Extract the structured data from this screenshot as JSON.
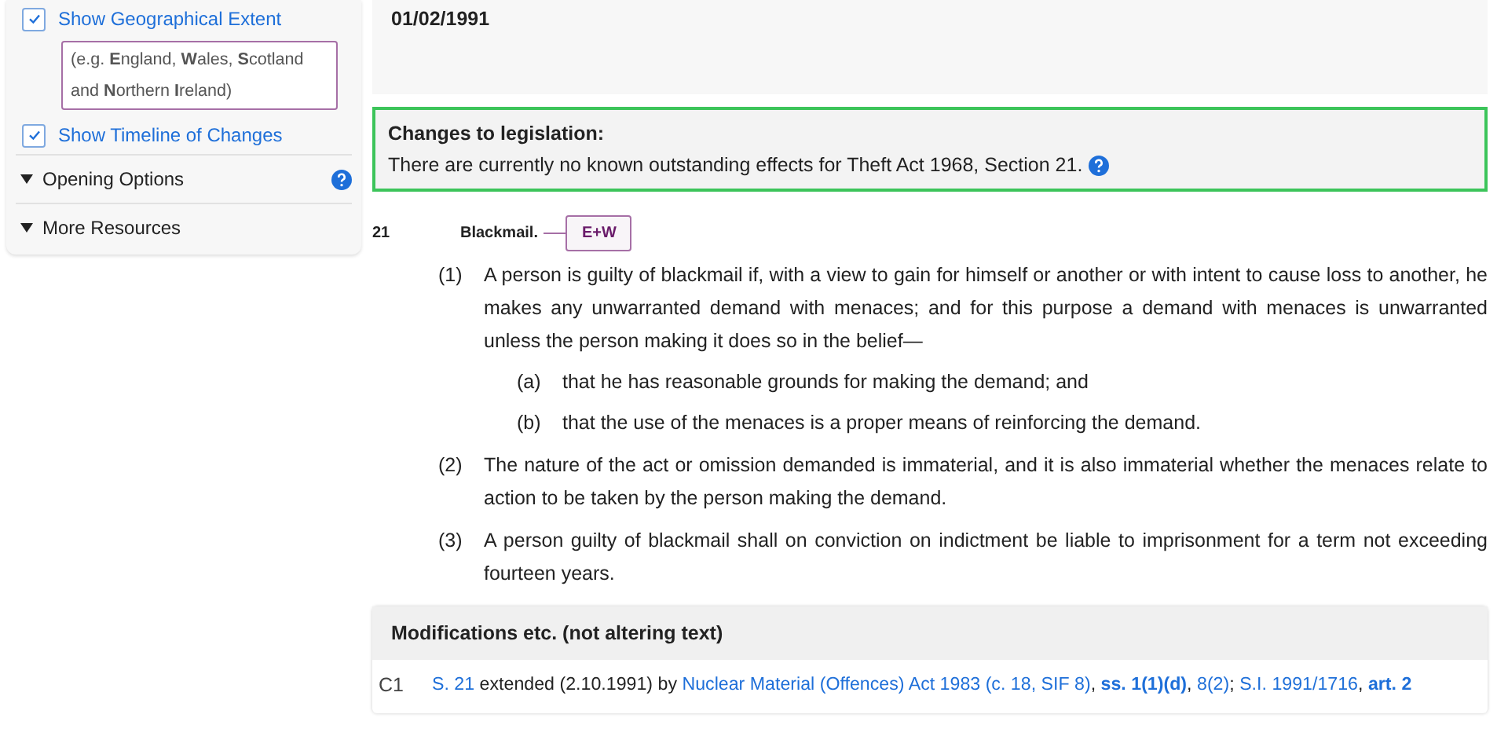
{
  "sidebar": {
    "options": [
      {
        "label": "Show Geographical Extent",
        "checked": true,
        "note": "(e.g. **E**ngland, **W**ales, **S**cotland and **N**orthern **I**reland)"
      },
      {
        "label": "Show Timeline of Changes",
        "checked": true
      }
    ],
    "sections": [
      {
        "label": "Opening Options",
        "expanded": false,
        "help": true
      },
      {
        "label": "More Resources",
        "expanded": false,
        "help": false
      }
    ]
  },
  "date": "01/02/1991",
  "changes": {
    "title": "Changes to legislation:",
    "text": "There are currently no known outstanding effects for Theft Act 1968, Section 21."
  },
  "section": {
    "number": "21",
    "title": "Blackmail.",
    "extent": "E+W",
    "paragraphs": [
      {
        "num": "(1)",
        "text": "A person is guilty of blackmail if, with a view to gain for himself or another or with intent to cause loss to another, he makes any unwarranted demand with menaces; and for this purpose a demand with menaces is unwarranted unless the person making it does so in the belief—",
        "children": [
          {
            "num": "(a)",
            "text": "that he has reasonable grounds for making the demand; and"
          },
          {
            "num": "(b)",
            "text": "that the use of the menaces is a proper means of reinforcing the demand."
          }
        ]
      },
      {
        "num": "(2)",
        "text": "The nature of the act or omission demanded is immaterial, and it is also immaterial whether the menaces relate to action to be taken by the person making the demand."
      },
      {
        "num": "(3)",
        "text": "A person guilty of blackmail shall on conviction on indictment be liable to imprisonment for a term not exceeding fourteen years."
      }
    ]
  },
  "modifications": {
    "title": "Modifications etc. (not altering text)",
    "items": [
      {
        "code": "C1",
        "segments": [
          {
            "kind": "link",
            "text": "S. 21"
          },
          {
            "kind": "text",
            "text": " extended (2.10.1991) by "
          },
          {
            "kind": "link",
            "text": "Nuclear Material (Offences) Act 1983 (c. 18, SIF 8)"
          },
          {
            "kind": "text",
            "text": ", "
          },
          {
            "kind": "boldlink",
            "text": "ss. 1(1)(d)"
          },
          {
            "kind": "text",
            "text": ", "
          },
          {
            "kind": "link",
            "text": "8(2)"
          },
          {
            "kind": "text",
            "text": "; "
          },
          {
            "kind": "link",
            "text": "S.I. 1991/1716"
          },
          {
            "kind": "text",
            "text": ", "
          },
          {
            "kind": "boldlink",
            "text": "art. 2"
          }
        ]
      }
    ]
  }
}
